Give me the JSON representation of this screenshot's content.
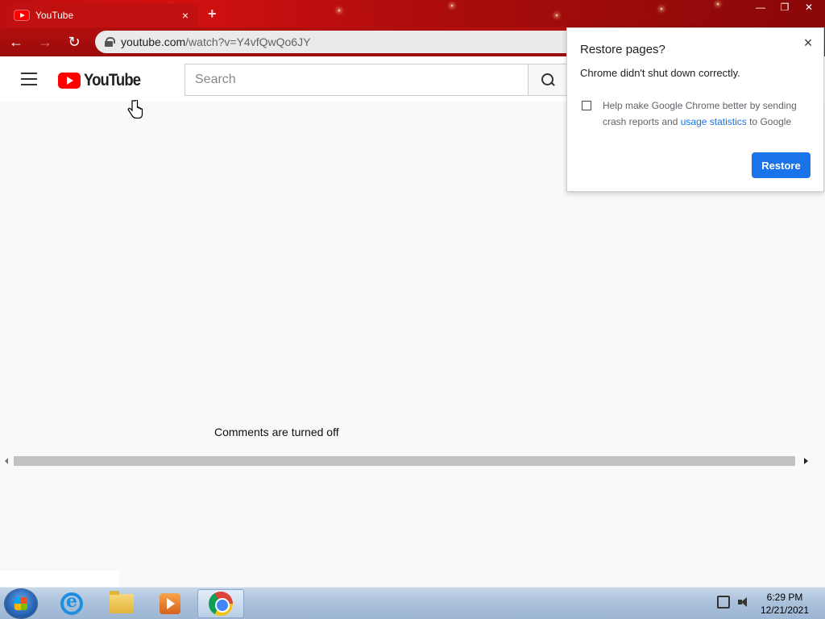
{
  "browser": {
    "tab_title": "YouTube",
    "tab_close": "×",
    "new_tab": "+",
    "window_controls": {
      "minimize": "—",
      "restore": "❐",
      "close": "✕"
    },
    "nav": {
      "back": "←",
      "forward": "→",
      "reload": "↻"
    },
    "url_host": "youtube.com",
    "url_path": "/watch?v=Y4vfQwQo6JY"
  },
  "youtube": {
    "logo_text": "YouTube",
    "search_placeholder": "Search"
  },
  "page": {
    "comments_status": "Comments are turned off"
  },
  "restore_dialog": {
    "title": "Restore pages?",
    "close": "×",
    "message": "Chrome didn't shut down correctly.",
    "help_text_before": "Help make Google Chrome better by sending crash reports and ",
    "help_link": "usage statistics",
    "help_text_after": " to Google",
    "checkbox_checked": false,
    "button_label": "Restore",
    "button_color": "#1a73e8"
  },
  "taskbar": {
    "items": [
      "start-orb",
      "internet-explorer-icon",
      "file-explorer-icon",
      "media-player-icon",
      "chrome-icon"
    ],
    "active_item": "chrome-icon",
    "time": "6:29 PM",
    "date": "12/21/2021"
  }
}
